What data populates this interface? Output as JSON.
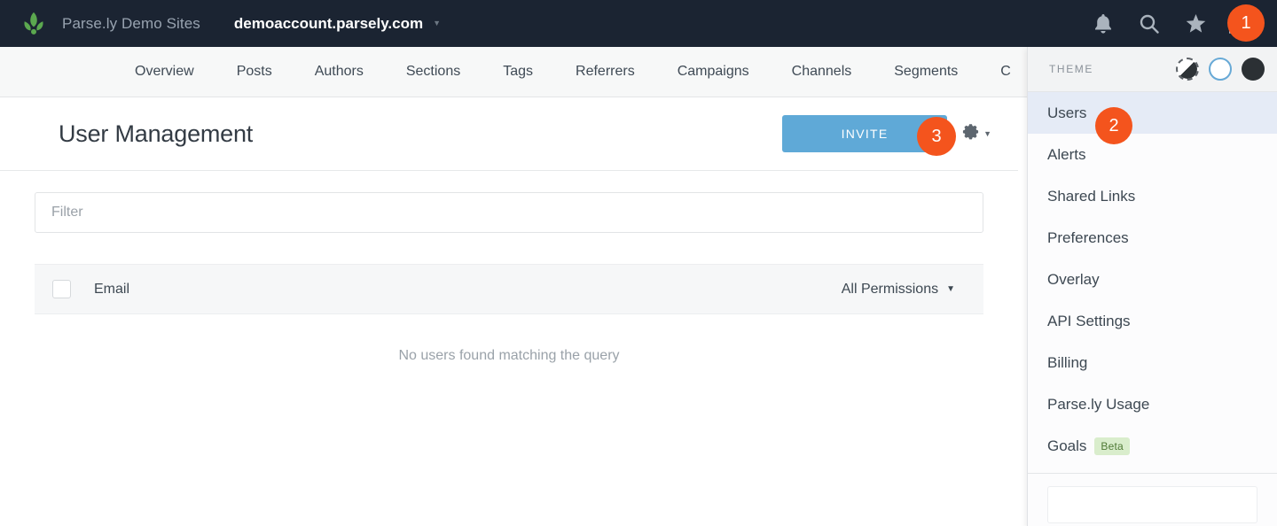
{
  "topbar": {
    "logo_icon": "parsely-leaf-logo",
    "brand": "Parse.ly Demo Sites",
    "account": "demoaccount.parsely.com",
    "account_caret": "▼",
    "icons": [
      {
        "name": "bell-icon",
        "label": "Notifications"
      },
      {
        "name": "search-icon",
        "label": "Search"
      },
      {
        "name": "star-icon",
        "label": "Favorites"
      },
      {
        "name": "user-icon",
        "label": "Account menu"
      }
    ],
    "user_caret": "▼"
  },
  "badges": [
    {
      "id": "1",
      "label": "1"
    },
    {
      "id": "2",
      "label": "2"
    },
    {
      "id": "3",
      "label": "3"
    }
  ],
  "nav": {
    "items": [
      {
        "label": "Overview"
      },
      {
        "label": "Posts"
      },
      {
        "label": "Authors"
      },
      {
        "label": "Sections"
      },
      {
        "label": "Tags"
      },
      {
        "label": "Referrers"
      },
      {
        "label": "Campaigns"
      },
      {
        "label": "Channels"
      },
      {
        "label": "Segments"
      },
      {
        "label": "C"
      }
    ]
  },
  "page": {
    "title": "User Management",
    "invite_label": "INVITE",
    "gear_icon": "gear-icon",
    "gear_caret": "▼"
  },
  "filter": {
    "value": "",
    "placeholder": "Filter"
  },
  "table": {
    "columns": {
      "email": "Email",
      "permissions": "All Permissions"
    },
    "permissions_caret": "▼",
    "empty_message": "No users found matching the query",
    "rows": []
  },
  "panel": {
    "theme": {
      "label": "THEME",
      "options": [
        {
          "name": "theme-auto",
          "selected": false
        },
        {
          "name": "theme-light",
          "selected": true
        },
        {
          "name": "theme-dark",
          "selected": false
        }
      ]
    },
    "items": [
      {
        "label": "Users",
        "active": true,
        "badge": ""
      },
      {
        "label": "Alerts",
        "active": false,
        "badge": ""
      },
      {
        "label": "Shared Links",
        "active": false,
        "badge": ""
      },
      {
        "label": "Preferences",
        "active": false,
        "badge": ""
      },
      {
        "label": "Overlay",
        "active": false,
        "badge": ""
      },
      {
        "label": "API Settings",
        "active": false,
        "badge": ""
      },
      {
        "label": "Billing",
        "active": false,
        "badge": ""
      },
      {
        "label": "Parse.ly Usage",
        "active": false,
        "badge": ""
      },
      {
        "label": "Goals",
        "active": false,
        "badge": "Beta"
      }
    ]
  },
  "colors": {
    "topbar_bg": "#1b2432",
    "accent_orange": "#f4541d",
    "invite_blue": "#5fa9d7",
    "leaf_green": "#5ba84f",
    "active_row": "#e5ebf6",
    "beta_green_bg": "#d9edcc",
    "beta_green_text": "#4f7a36"
  }
}
